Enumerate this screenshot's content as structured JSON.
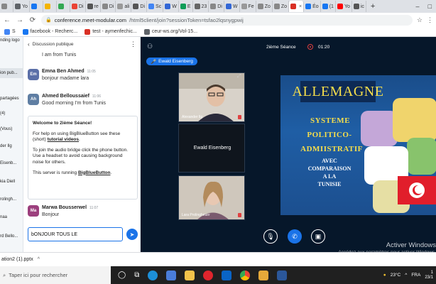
{
  "browser": {
    "tabs": [
      {
        "label": "",
        "color": "#888"
      },
      {
        "label": "Yo",
        "color": "#5f6368"
      },
      {
        "label": "",
        "color": "#1877f2"
      },
      {
        "label": "",
        "color": "#f4b400"
      },
      {
        "label": "",
        "color": "#34a853"
      },
      {
        "label": "Di",
        "color": "#ea4335"
      },
      {
        "label": "re",
        "color": "#555"
      },
      {
        "label": "Di",
        "color": "#888"
      },
      {
        "label": "ali",
        "color": "#999"
      },
      {
        "label": "Di",
        "color": "#555"
      },
      {
        "label": "Sc",
        "color": "#4285f4"
      },
      {
        "label": "W",
        "color": "#3367d6"
      },
      {
        "label": "E",
        "color": "#0f9d58"
      },
      {
        "label": "23",
        "color": "#666"
      },
      {
        "label": "Di",
        "color": "#888"
      },
      {
        "label": "W",
        "color": "#3367d6"
      },
      {
        "label": "Fe",
        "color": "#999"
      },
      {
        "label": "Zo",
        "color": "#888"
      },
      {
        "label": "Zo",
        "color": "#888"
      },
      {
        "label": "",
        "color": "#d93025",
        "active": true
      },
      {
        "label": "Éo",
        "color": "#1877f2"
      },
      {
        "label": "(1",
        "color": "#1877f2"
      },
      {
        "label": "Yo",
        "color": "#ff0000"
      },
      {
        "label": "ic",
        "color": "#555"
      }
    ],
    "url_host": "conference.meet-modular.com",
    "url_path": "/html5client/join?sessionToken=tsfao2lqsnygpwij",
    "bookmarks": [
      {
        "label": "S",
        "color": "#4285f4"
      },
      {
        "label": "facebook - Recherc...",
        "color": "#1877f2"
      },
      {
        "label": "test - aymenfechic...",
        "color": "#d93025"
      },
      {
        "label": "ceur-ws.org/Vol-15...",
        "color": "#5f6368"
      }
    ]
  },
  "userlist": {
    "items": [
      {
        "label": "nding logo"
      },
      {
        "label": "ion pub..."
      },
      {
        "label": "partagées"
      },
      {
        "label": "(4)"
      },
      {
        "label": "(Vous)"
      },
      {
        "label": "der Ilg"
      },
      {
        "label": "Eisenb..."
      },
      {
        "label": "kia Diell"
      },
      {
        "label": "rolingh..."
      },
      {
        "label": "naa"
      },
      {
        "label": "rd Bello..."
      }
    ]
  },
  "chat": {
    "header": "Discussion publique",
    "partial_message": "I am from Tunis",
    "messages": [
      {
        "initials": "Em",
        "name": "Emna Ben Ahmed",
        "time": "11:05",
        "text": "bonjour madame lara",
        "color": "#5b6fa8"
      },
      {
        "initials": "Ah",
        "name": "Ahmed Belloussaief",
        "time": "11:06",
        "text": "Good morning I'm from Tunis",
        "color": "#5f7ea3"
      }
    ],
    "welcome": {
      "title": "Welcome to 2ième Séance!",
      "help_before": "For help on using BigBlueButton see these (short) ",
      "help_link": "tutorial videos",
      "help_after": ".",
      "audio": "To join the audio bridge click the phone button. Use a headset to avoid causing background noise for others.",
      "server_before": "This server is running ",
      "server_link": "BigBlueButton",
      "server_after": "."
    },
    "last_message": {
      "initials": "Ma",
      "name": "Marwa Bousserwel",
      "time": "11:07",
      "text": "Bonjour",
      "color": "#9c3f7d"
    },
    "input_value": "bONJOUR TOUS LE"
  },
  "stage": {
    "session_title": "2ième Séance",
    "timer": "01:20",
    "talker": "Ewald Eisenberg",
    "videos": [
      {
        "name": "Alexander Ilg"
      },
      {
        "name": "Ewald Eisenberg"
      },
      {
        "name": "Lara Prolingheuer"
      }
    ],
    "slide": {
      "title": "ALLEMAGNE",
      "lines": [
        "SYSTEME",
        "POLITICO-",
        "ADMIISTRATIF"
      ],
      "small_lines": [
        "AVEC",
        "COMPARAISON",
        "A LA",
        "TUNISIE"
      ]
    }
  },
  "windows": {
    "activate_title": "Activer Windows",
    "activate_sub": "Accédez aux paramètres pour activer Windows.",
    "download_file": "ation2 (1).pptx",
    "search_placeholder": "Taper ici pour rechercher",
    "weather": "23°C",
    "lang": "FRA",
    "time": "1",
    "date": "23/1"
  }
}
